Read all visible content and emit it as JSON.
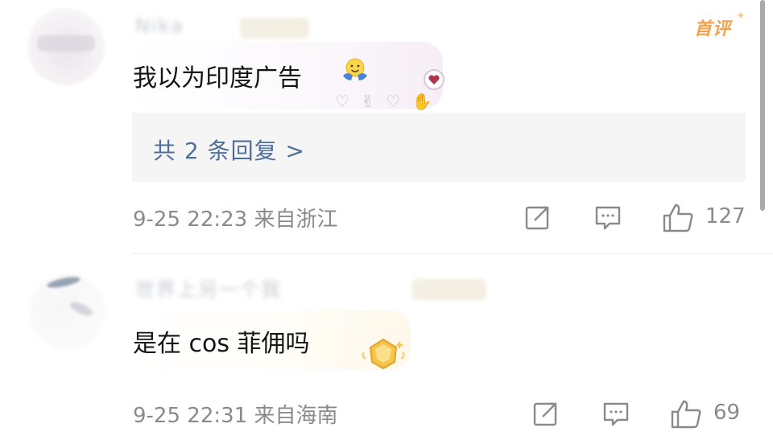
{
  "comments": [
    {
      "username": "Nika",
      "tag": "首评",
      "text": "我以为印度广告",
      "reply_summary": "共 2 条回复 >",
      "time": "9-25 22:23",
      "location": "来自浙江",
      "likes": "127"
    },
    {
      "username": "世界上另一个我",
      "text": "是在 cos 菲佣吗",
      "time": "9-25 22:31",
      "location": "来自海南",
      "likes": "69"
    }
  ],
  "icons": {
    "share": "share-icon",
    "comment": "comment-icon",
    "like": "thumbs-up-icon"
  },
  "colors": {
    "reply_link": "#4e6f9c",
    "first_tag": "#f5a24e",
    "meta_text": "#8a8a8a"
  }
}
